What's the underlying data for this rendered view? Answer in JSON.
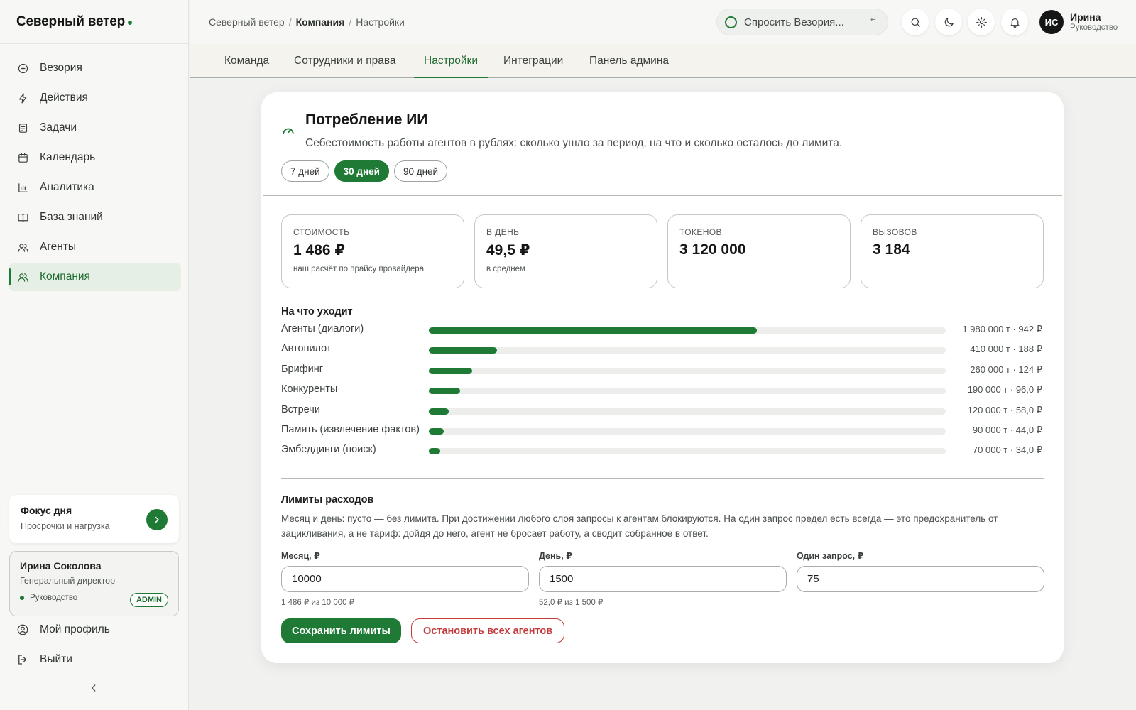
{
  "brand": {
    "name": "Северный ветер"
  },
  "sidebar": {
    "items": [
      {
        "label": "Везория",
        "icon": "chat-icon"
      },
      {
        "label": "Действия",
        "icon": "bolt-icon"
      },
      {
        "label": "Задачи",
        "icon": "tasks-icon"
      },
      {
        "label": "Календарь",
        "icon": "calendar-icon"
      },
      {
        "label": "Аналитика",
        "icon": "analytics-icon"
      },
      {
        "label": "База знаний",
        "icon": "book-icon"
      },
      {
        "label": "Агенты",
        "icon": "agents-icon"
      },
      {
        "label": "Компания",
        "icon": "company-icon",
        "active": true
      }
    ],
    "focus": {
      "title": "Фокус дня",
      "subtitle": "Просрочки и нагрузка"
    },
    "user": {
      "name": "Ирина Соколова",
      "position": "Генеральный директор",
      "role": "Руководство",
      "badge": "ADMIN"
    },
    "profile_label": "Мой профиль",
    "logout_label": "Выйти"
  },
  "header": {
    "breadcrumbs": [
      "Северный ветер",
      "Компания",
      "Настройки"
    ],
    "ask_placeholder": "Спросить Везория...",
    "ask_hint": "↵",
    "avatar_initials": "ИС",
    "user_name": "Ирина",
    "user_role": "Руководство"
  },
  "tabs": [
    {
      "label": "Команда"
    },
    {
      "label": "Сотрудники и права"
    },
    {
      "label": "Настройки",
      "active": true
    },
    {
      "label": "Интеграции"
    },
    {
      "label": "Панель админа"
    }
  ],
  "usage": {
    "title": "Потребление ИИ",
    "subtitle": "Себестоимость работы агентов в рублях: сколько ушло за период, на что и сколько осталось до лимита.",
    "periods": [
      {
        "label": "7 дней"
      },
      {
        "label": "30 дней",
        "active": true
      },
      {
        "label": "90 дней"
      }
    ],
    "stats": [
      {
        "label": "СТОИМОСТЬ",
        "value": "1 486 ₽",
        "hint": "наш расчёт по прайсу провайдера"
      },
      {
        "label": "В ДЕНЬ",
        "value": "49,5 ₽",
        "hint": "в среднем"
      },
      {
        "label": "ТОКЕНОВ",
        "value": "3 120 000",
        "hint": ""
      },
      {
        "label": "ВЫЗОВОВ",
        "value": "3 184",
        "hint": ""
      }
    ],
    "spend_title": "На что уходит",
    "spend": [
      {
        "label": "Агенты (диалоги)",
        "value": "1 980 000 т · 942 ₽",
        "share": 0.635
      },
      {
        "label": "Автопилот",
        "value": "410 000 т · 188 ₽",
        "share": 0.132
      },
      {
        "label": "Брифинг",
        "value": "260 000 т · 124 ₽",
        "share": 0.084
      },
      {
        "label": "Конкуренты",
        "value": "190 000 т · 96,0 ₽",
        "share": 0.061
      },
      {
        "label": "Встречи",
        "value": "120 000 т · 58,0 ₽",
        "share": 0.039
      },
      {
        "label": "Память (извлечение фактов)",
        "value": "90 000 т · 44,0 ₽",
        "share": 0.029
      },
      {
        "label": "Эмбеддинги (поиск)",
        "value": "70 000 т · 34,0 ₽",
        "share": 0.022
      }
    ]
  },
  "limits": {
    "title": "Лимиты расходов",
    "description": "Месяц и день: пусто — без лимита. При достижении любого слоя запросы к агентам блокируются. На один запрос предел есть всегда — это предохранитель от зацикливания, а не тариф: дойдя до него, агент не бросает работу, а сводит собранное в ответ.",
    "fields": [
      {
        "label": "Месяц, ₽",
        "value": "10000",
        "hint": "1 486 ₽ из 10 000 ₽"
      },
      {
        "label": "День, ₽",
        "value": "1500",
        "hint": "52,0 ₽ из 1 500 ₽"
      },
      {
        "label": "Один запрос, ₽",
        "value": "75",
        "hint": ""
      }
    ],
    "save_label": "Сохранить лимиты",
    "stop_label": "Остановить всех агентов"
  },
  "colors": {
    "accent": "#1f7a35",
    "danger": "#c43a3a"
  }
}
